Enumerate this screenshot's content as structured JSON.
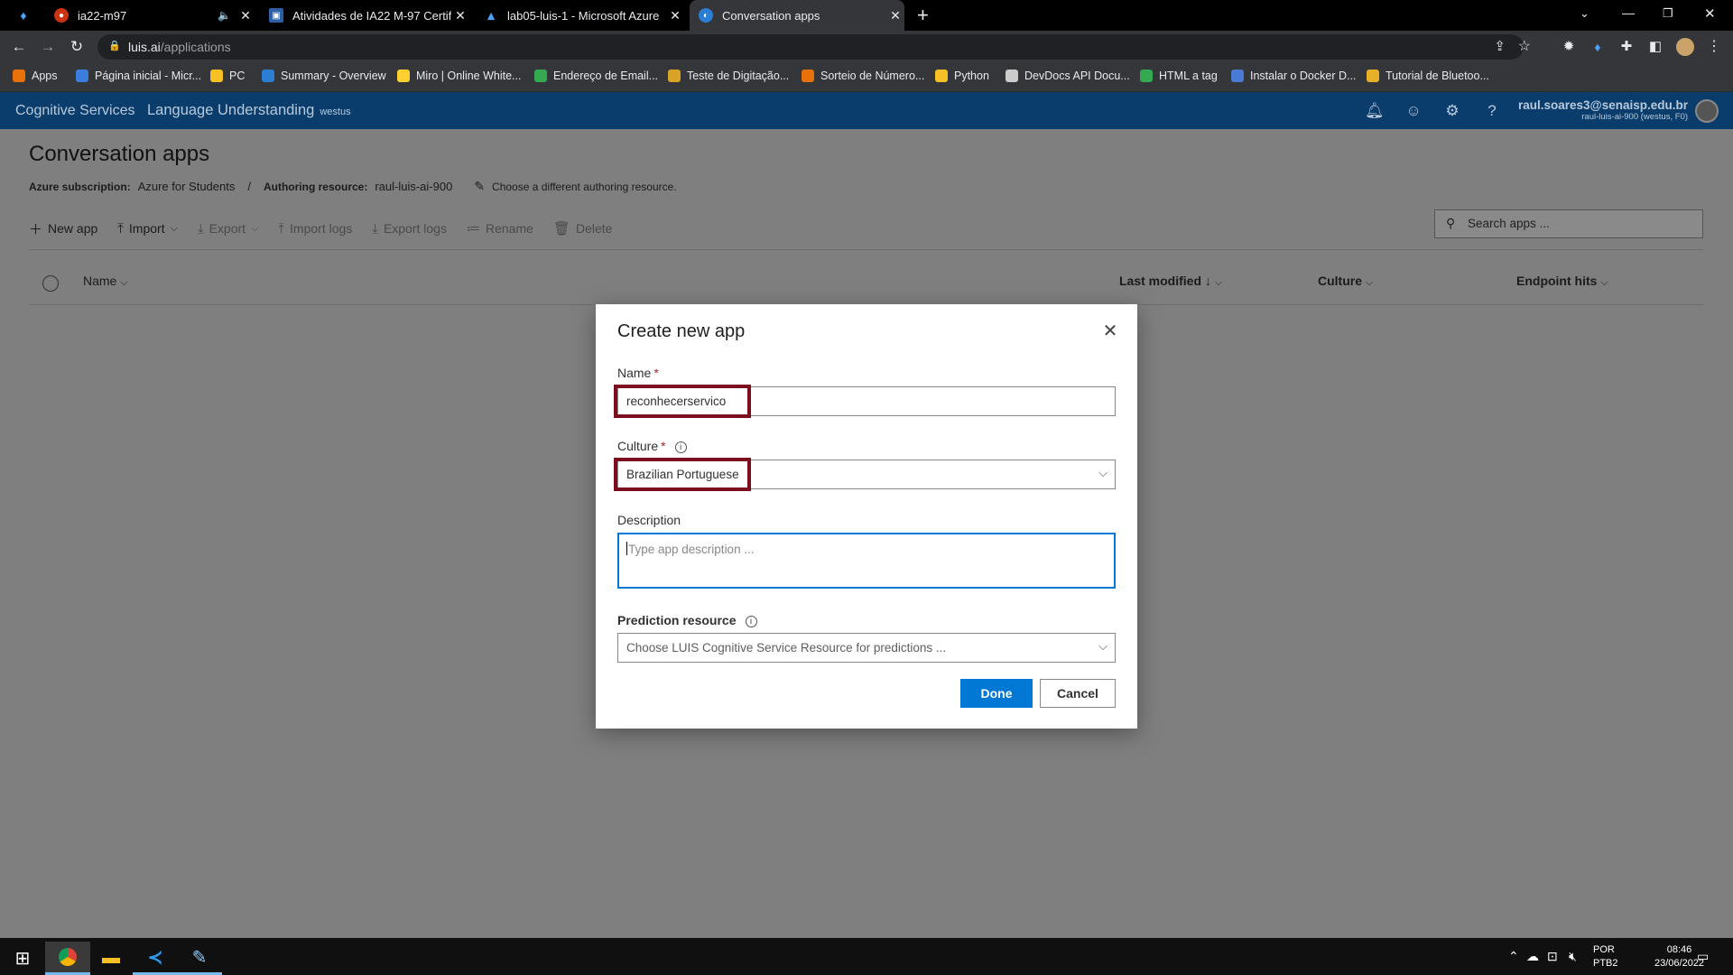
{
  "browser": {
    "tabs": [
      {
        "title": "ia22-m97",
        "fav": "#c31",
        "muted": true
      },
      {
        "title": "Atividades de IA22 M-97 Certific",
        "fav": "#2b5fa8"
      },
      {
        "title": "lab05-luis-1 - Microsoft Azure",
        "fav": "#0078d4"
      },
      {
        "title": "Conversation apps",
        "fav": "#2a7fd4",
        "active": true
      }
    ],
    "new_tab": "+",
    "url_host": "luis.ai",
    "url_path": "/applications",
    "bookmarks": [
      {
        "label": "Apps",
        "color": "#e8710a"
      },
      {
        "label": "Página inicial - Micr...",
        "color": "#3b7ddd"
      },
      {
        "label": "PC",
        "color": "#f6c026"
      },
      {
        "label": "Summary - Overview",
        "color": "#2a7fd4"
      },
      {
        "label": "Miro | Online White...",
        "color": "#ffd02f"
      },
      {
        "label": "Endereço de Email...",
        "color": "#34a853"
      },
      {
        "label": "Teste de Digitação...",
        "color": "#d8a428"
      },
      {
        "label": "Sorteio de Número...",
        "color": "#e8710a"
      },
      {
        "label": "Python",
        "color": "#f6c026"
      },
      {
        "label": "DevDocs API Docu...",
        "color": "#cccccc"
      },
      {
        "label": "HTML a tag",
        "color": "#34a853"
      },
      {
        "label": "Instalar o Docker D...",
        "color": "#4a7ad4"
      },
      {
        "label": "Tutorial de Bluetoo...",
        "color": "#e8b028"
      }
    ]
  },
  "header": {
    "brand": "Cognitive Services",
    "product": "Language Understanding",
    "region": "westus",
    "user_email": "raul.soares3@senaisp.edu.br",
    "user_resource": "raul-luis-ai-900 (westus, F0)"
  },
  "page": {
    "title": "Conversation apps",
    "subscription_label": "Azure subscription:",
    "subscription_value": "Azure for Students",
    "separator": "/",
    "authoring_label": "Authoring resource:",
    "authoring_value": "raul-luis-ai-900",
    "change_link": "Choose a different authoring resource.",
    "toolbar": {
      "new_app": "New app",
      "import": "Import",
      "export": "Export",
      "import_logs": "Import logs",
      "export_logs": "Export logs",
      "rename": "Rename",
      "delete": "Delete"
    },
    "search_placeholder": "Search apps ...",
    "columns": {
      "name": "Name",
      "last_modified": "Last modified",
      "culture": "Culture",
      "endpoint_hits": "Endpoint hits"
    }
  },
  "modal": {
    "title": "Create new app",
    "name_label": "Name",
    "name_value": "reconhecerservico",
    "culture_label": "Culture",
    "culture_value": "Brazilian Portuguese",
    "description_label": "Description",
    "description_placeholder": "Type app description ...",
    "prediction_label": "Prediction resource",
    "prediction_placeholder": "Choose LUIS Cognitive Service Resource for predictions ...",
    "done": "Done",
    "cancel": "Cancel",
    "required_mark": "*"
  },
  "taskbar": {
    "lang_1": "POR",
    "lang_2": "PTB2",
    "time": "08:46",
    "date": "23/06/2022"
  }
}
